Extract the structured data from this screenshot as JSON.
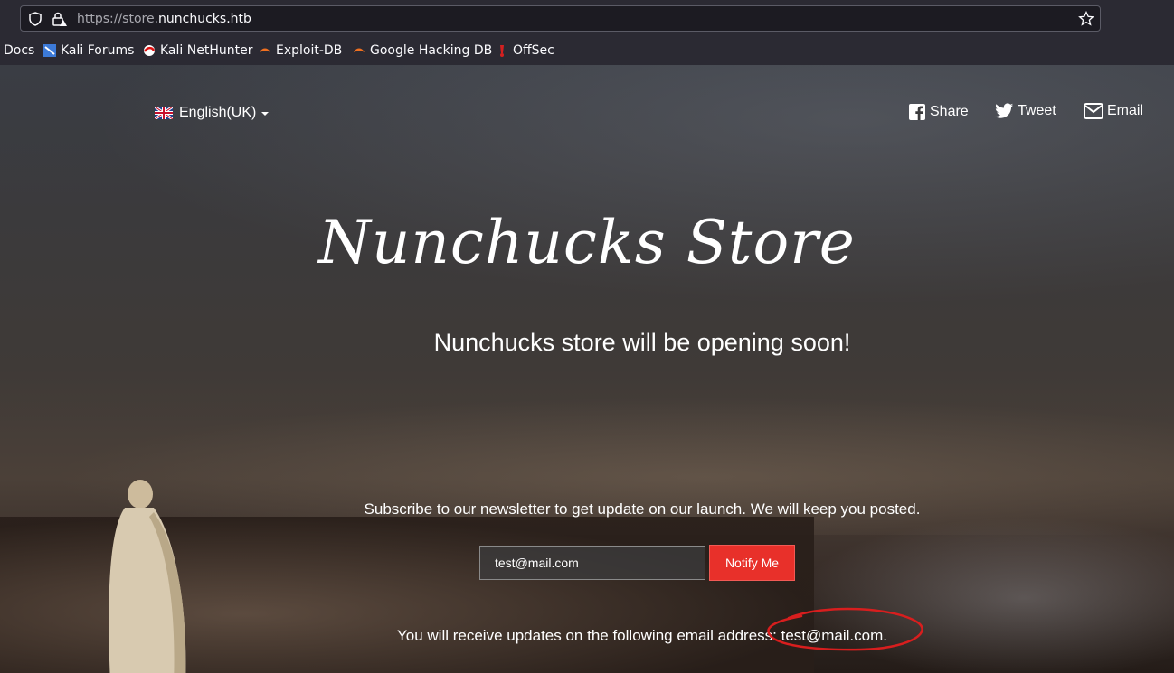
{
  "browser": {
    "url_prefix": "https://store.",
    "url_domain": "nunchucks.htb",
    "bookmarks": [
      {
        "label": "Docs",
        "icon": "docs-icon"
      },
      {
        "label": "Kali Forums",
        "icon": "kali-forums-icon"
      },
      {
        "label": "Kali NetHunter",
        "icon": "kali-nethunter-icon"
      },
      {
        "label": "Exploit-DB",
        "icon": "exploit-db-icon"
      },
      {
        "label": "Google Hacking DB",
        "icon": "google-hacking-db-icon"
      },
      {
        "label": "OffSec",
        "icon": "offsec-icon"
      }
    ]
  },
  "header": {
    "language": "English(UK)",
    "share": "Share",
    "tweet": "Tweet",
    "email": "Email"
  },
  "hero": {
    "title": "Nunchucks Store",
    "lead": "Nunchucks store will be opening soon!"
  },
  "subscribe": {
    "text": "Subscribe to our newsletter to get update on our launch. We will keep you posted.",
    "email_value": "test@mail.com",
    "button_label": "Notify Me",
    "confirmation": "You will receive updates on the following email address: test@mail.com."
  },
  "colors": {
    "accent": "#e8302a",
    "annotation": "#d81e1e"
  }
}
